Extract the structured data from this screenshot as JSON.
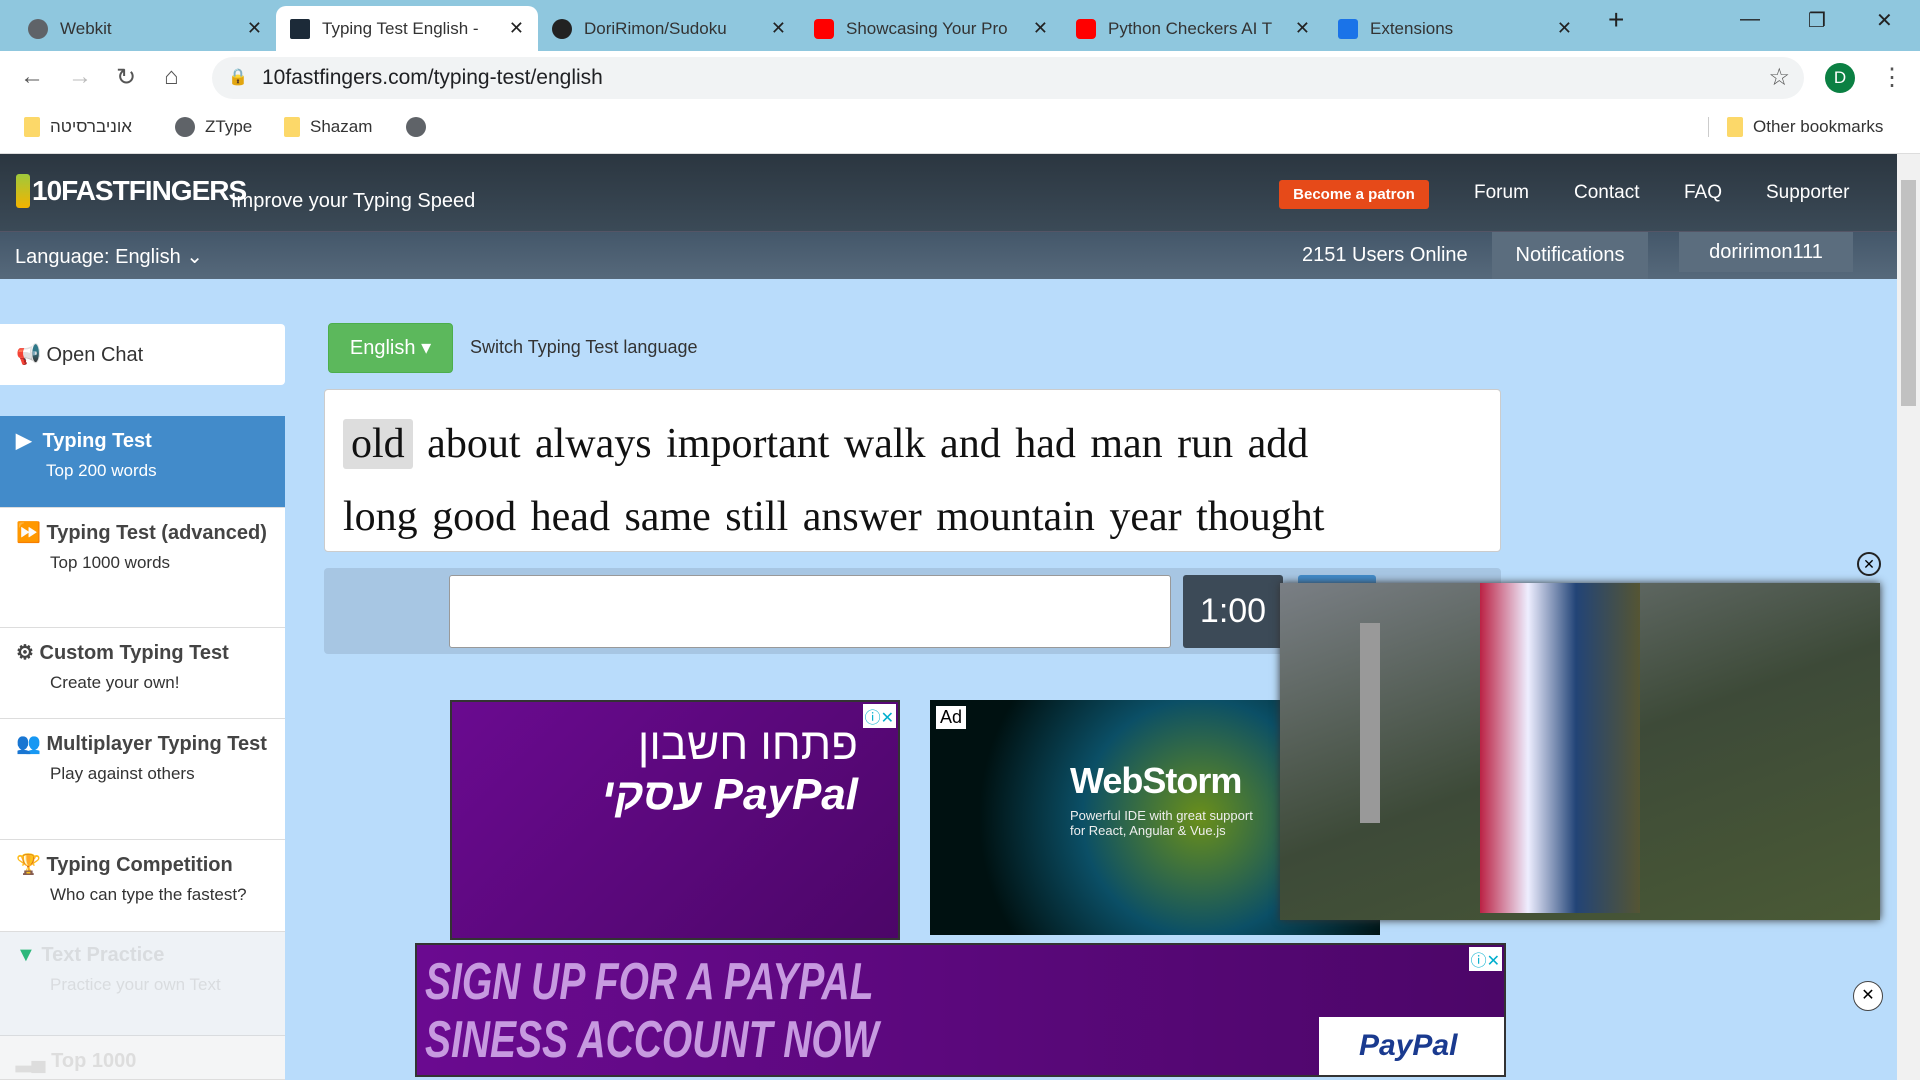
{
  "browser": {
    "tabs": [
      {
        "title": "Webkit",
        "icon": "globe-icon"
      },
      {
        "title": "Typing Test English -",
        "icon": "10ff-icon",
        "active": true
      },
      {
        "title": "DoriRimon/Sudoku",
        "icon": "github-icon"
      },
      {
        "title": "Showcasing Your Pro",
        "icon": "youtube-icon"
      },
      {
        "title": "Python Checkers AI T",
        "icon": "youtube-icon"
      },
      {
        "title": "Extensions",
        "icon": "puzzle-icon"
      }
    ],
    "url": "10fastfingers.com/typing-test/english",
    "profile_initial": "D",
    "bookmarks": [
      "אוניברסיטה",
      "ZType",
      "Shazam",
      ""
    ],
    "other_bookmarks": "Other bookmarks"
  },
  "site": {
    "logo": "10FASTFINGERS",
    "tagline": "Improve your Typing Speed",
    "patron": "Become a patron",
    "nav": [
      "Forum",
      "Contact",
      "FAQ",
      "Supporter"
    ],
    "language": "Language: English",
    "users_online": "2151 Users Online",
    "notifications": "Notifications",
    "username": "doririmon111",
    "colors": {
      "patron": "#e64a19",
      "active": "#428bca",
      "green": "#5cb85c"
    }
  },
  "sidebar": {
    "open_chat": "Open Chat",
    "items": [
      {
        "title": "Typing Test",
        "sub": "Top 200 words"
      },
      {
        "title": "Typing Test (advanced)",
        "sub": "Top 1000 words"
      },
      {
        "title": "Custom Typing Test",
        "sub": "Create your own!"
      },
      {
        "title": "Multiplayer Typing Test",
        "sub": "Play against others"
      },
      {
        "title": "Typing Competition",
        "sub": "Who can type the fastest?"
      },
      {
        "title": "Text Practice",
        "sub": "Practice your own Text"
      },
      {
        "title": "Top 1000",
        "sub": ""
      }
    ]
  },
  "test": {
    "lang_button": "English",
    "switch_label": "Switch Typing Test language",
    "current_word": "old",
    "line1": "about always important walk and had man run add",
    "line2": "long good head same still answer mountain year thought",
    "input_value": "",
    "timer": "1:00"
  },
  "ads": {
    "ad1_line1": "פתחו חשבון",
    "ad1_line2": "עסקי PayPal",
    "ad2_label": "Ad",
    "ad2_title": "WebStorm",
    "ad2_sub": "Powerful IDE with great support for React, Angular & Vue.js",
    "banner_line1": "SIGN UP FOR A PAYPAL",
    "banner_line2": "SINESS ACCOUNT NOW",
    "banner_brand": "PayPal"
  }
}
